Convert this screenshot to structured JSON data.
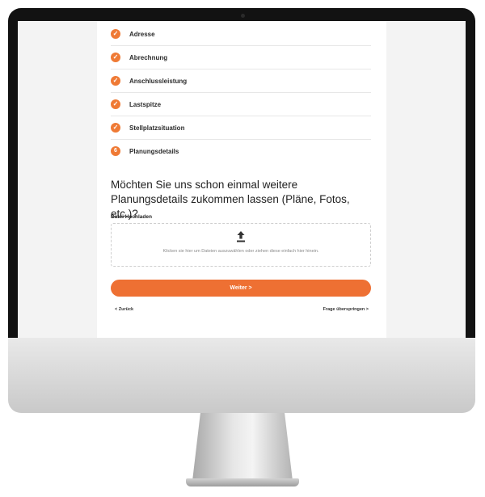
{
  "steps": [
    {
      "label": "Adresse",
      "state": "done"
    },
    {
      "label": "Abrechnung",
      "state": "done"
    },
    {
      "label": "Anschlussleistung",
      "state": "done"
    },
    {
      "label": "Lastspitze",
      "state": "done"
    },
    {
      "label": "Stellplatzsituation",
      "state": "done"
    },
    {
      "label": "Planungsdetails",
      "state": "current",
      "number": "6"
    }
  ],
  "check_glyph": "✓",
  "question": "Möchten Sie uns schon einmal weitere Planungsdetails zukommen lassen (Pläne, Fotos, etc.)?",
  "upload": {
    "label": "Datei Hochladen",
    "icon": "upload-icon",
    "hint": "Klicken sie hier um Dateien auszuwählen oder ziehen diese einfach hier hinein."
  },
  "buttons": {
    "next": "Weiter >",
    "back": "< Zurück",
    "skip": "Frage überspringen >"
  },
  "colors": {
    "accent": "#ee7033",
    "bezel": "#121212"
  }
}
